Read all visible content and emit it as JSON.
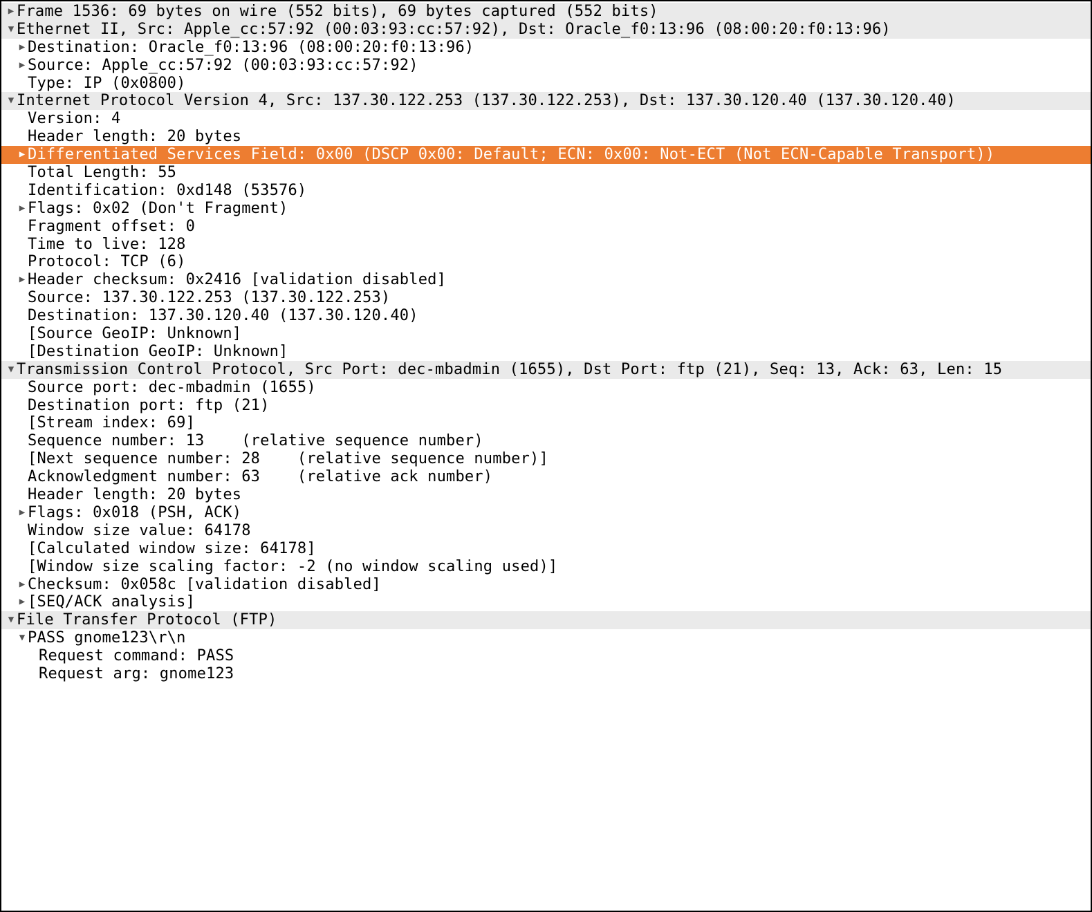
{
  "frame_header": "Frame 1536: 69 bytes on wire (552 bits), 69 bytes captured (552 bits)",
  "ethernet": {
    "header": "Ethernet II, Src: Apple_cc:57:92 (00:03:93:cc:57:92), Dst: Oracle_f0:13:96 (08:00:20:f0:13:96)",
    "destination": "Destination: Oracle_f0:13:96 (08:00:20:f0:13:96)",
    "source": "Source: Apple_cc:57:92 (00:03:93:cc:57:92)",
    "type": "Type: IP (0x0800)"
  },
  "ip": {
    "header": "Internet Protocol Version 4, Src: 137.30.122.253 (137.30.122.253), Dst: 137.30.120.40 (137.30.120.40)",
    "version": "Version: 4",
    "hdr_len": "Header length: 20 bytes",
    "dsfield": "Differentiated Services Field: 0x00 (DSCP 0x00: Default; ECN: 0x00: Not-ECT (Not ECN-Capable Transport))",
    "total_len": "Total Length: 55",
    "id": "Identification: 0xd148 (53576)",
    "flags": "Flags: 0x02 (Don't Fragment)",
    "frag_offset": "Fragment offset: 0",
    "ttl": "Time to live: 128",
    "protocol": "Protocol: TCP (6)",
    "checksum": "Header checksum: 0x2416 [validation disabled]",
    "src": "Source: 137.30.122.253 (137.30.122.253)",
    "dst": "Destination: 137.30.120.40 (137.30.120.40)",
    "src_geoip": "[Source GeoIP: Unknown]",
    "dst_geoip": "[Destination GeoIP: Unknown]"
  },
  "tcp": {
    "header": "Transmission Control Protocol, Src Port: dec-mbadmin (1655), Dst Port: ftp (21), Seq: 13, Ack: 63, Len: 15",
    "srcport": "Source port: dec-mbadmin (1655)",
    "dstport": "Destination port: ftp (21)",
    "stream": "[Stream index: 69]",
    "seq": "Sequence number: 13    (relative sequence number)",
    "nxtseq": "[Next sequence number: 28    (relative sequence number)]",
    "ack": "Acknowledgment number: 63    (relative ack number)",
    "hdr_len": "Header length: 20 bytes",
    "flags": "Flags: 0x018 (PSH, ACK)",
    "window": "Window size value: 64178",
    "calc_window": "[Calculated window size: 64178]",
    "scaling": "[Window size scaling factor: -2 (no window scaling used)]",
    "checksum": "Checksum: 0x058c [validation disabled]",
    "seqack": "[SEQ/ACK analysis]"
  },
  "ftp": {
    "header": "File Transfer Protocol (FTP)",
    "line": "PASS gnome123\\r\\n",
    "req_cmd": "Request command: PASS",
    "req_arg": "Request arg: gnome123"
  },
  "colors": {
    "header_bg": "#eaeaea",
    "selected_bg": "#ed7d31"
  }
}
